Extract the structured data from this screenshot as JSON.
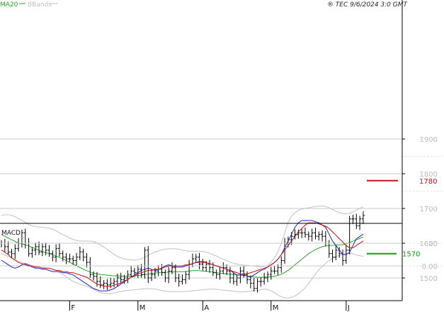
{
  "header": {
    "ma_label": "MA20",
    "bbands_label": "BBands",
    "copyright": "® TEC 9/6/2024 3:0 GMT"
  },
  "colors": {
    "ma": "#22aa22",
    "bbands": "#c0c0c0",
    "price_bar": "#000000",
    "macd_line": "#2222cc",
    "signal_line": "#cc1111",
    "resistance": "#cc1111",
    "support": "#119911",
    "grid": "#c8c8c8"
  },
  "chart_data": [
    {
      "type": "bar",
      "subtype": "ohlc",
      "x_labels": [
        "F",
        "M",
        "A",
        "M",
        "J"
      ],
      "x_label_positions": [
        20,
        40,
        59,
        79,
        101
      ],
      "y_ticks": [
        1500,
        1600,
        1700,
        1800,
        1900
      ],
      "ylim": [
        1420,
        1960
      ],
      "levels": [
        {
          "value": 1780,
          "label": "1780",
          "color": "#cc1111"
        },
        {
          "value": 1570,
          "label": "1570",
          "color": "#119911"
        }
      ],
      "close": [
        1600,
        1590,
        1575,
        1570,
        1585,
        1600,
        1630,
        1600,
        1570,
        1580,
        1590,
        1575,
        1590,
        1580,
        1570,
        1560,
        1585,
        1570,
        1560,
        1555,
        1555,
        1550,
        1560,
        1575,
        1560,
        1545,
        1510,
        1505,
        1490,
        1480,
        1485,
        1480,
        1485,
        1490,
        1500,
        1495,
        1500,
        1510,
        1520,
        1515,
        1525,
        1510,
        1580,
        1500,
        1510,
        1520,
        1525,
        1515,
        1500,
        1520,
        1530,
        1500,
        1490,
        1495,
        1510,
        1540,
        1555,
        1560,
        1540,
        1530,
        1540,
        1530,
        1515,
        1510,
        1520,
        1530,
        1520,
        1500,
        1490,
        1500,
        1520,
        1510,
        1495,
        1485,
        1470,
        1490,
        1490,
        1500,
        1510,
        1520,
        1520,
        1530,
        1550,
        1600,
        1610,
        1620,
        1625,
        1630,
        1630,
        1625,
        1620,
        1630,
        1620,
        1625,
        1620,
        1600,
        1570,
        1560,
        1580,
        1570,
        1550,
        1580,
        1670,
        1670,
        1650,
        1670,
        1680
      ],
      "ma20": [
        1625,
        1620,
        1615,
        1610,
        1605,
        1600,
        1598,
        1596,
        1592,
        1588,
        1584,
        1580,
        1576,
        1573,
        1570,
        1567,
        1563,
        1559,
        1555,
        1550,
        1545,
        1540,
        1535,
        1530,
        1525,
        1521,
        1517,
        1514,
        1512,
        1510,
        1509,
        1508,
        1507,
        1506,
        1506,
        1505,
        1505,
        1505,
        1505,
        1506,
        1507,
        1508,
        1510,
        1511,
        1513,
        1514,
        1515,
        1516,
        1516,
        1517,
        1517,
        1518,
        1518,
        1518,
        1519,
        1520,
        1521,
        1521,
        1521,
        1520,
        1519,
        1518,
        1517,
        1515,
        1514,
        1513,
        1512,
        1511,
        1510,
        1509,
        1508,
        1507,
        1506,
        1505,
        1503,
        1502,
        1502,
        1502,
        1503,
        1504,
        1505,
        1507,
        1511,
        1516,
        1522,
        1530,
        1538,
        1546,
        1554,
        1562,
        1570,
        1576,
        1582,
        1586,
        1590,
        1592,
        1593,
        1594,
        1595,
        1595,
        1596,
        1598,
        1602,
        1606,
        1610,
        1614,
        1618
      ],
      "bb_upper": [
        1680,
        1682,
        1682,
        1680,
        1676,
        1671,
        1666,
        1660,
        1654,
        1650,
        1648,
        1647,
        1646,
        1645,
        1643,
        1640,
        1636,
        1630,
        1625,
        1620,
        1615,
        1611,
        1608,
        1606,
        1606,
        1606,
        1606,
        1605,
        1600,
        1595,
        1589,
        1582,
        1575,
        1568,
        1562,
        1558,
        1555,
        1553,
        1552,
        1551,
        1552,
        1555,
        1560,
        1565,
        1570,
        1575,
        1578,
        1581,
        1583,
        1584,
        1584,
        1584,
        1583,
        1580,
        1578,
        1577,
        1577,
        1577,
        1577,
        1576,
        1574,
        1571,
        1567,
        1563,
        1558,
        1554,
        1550,
        1546,
        1542,
        1540,
        1538,
        1537,
        1536,
        1535,
        1534,
        1533,
        1533,
        1534,
        1536,
        1545,
        1558,
        1575,
        1600,
        1630,
        1660,
        1678,
        1688,
        1695,
        1698,
        1700,
        1702,
        1704,
        1706,
        1707,
        1707,
        1706,
        1702,
        1697,
        1692,
        1688,
        1685,
        1685,
        1686,
        1690,
        1695,
        1700,
        1705
      ],
      "bb_lower": [
        1570,
        1566,
        1562,
        1558,
        1553,
        1548,
        1544,
        1541,
        1538,
        1535,
        1533,
        1531,
        1530,
        1529,
        1528,
        1526,
        1522,
        1516,
        1510,
        1503,
        1496,
        1490,
        1486,
        1482,
        1479,
        1476,
        1472,
        1468,
        1462,
        1458,
        1456,
        1455,
        1455,
        1457,
        1459,
        1461,
        1463,
        1464,
        1465,
        1466,
        1467,
        1468,
        1469,
        1469,
        1469,
        1468,
        1466,
        1464,
        1462,
        1461,
        1461,
        1461,
        1461,
        1461,
        1461,
        1462,
        1463,
        1464,
        1465,
        1466,
        1467,
        1468,
        1468,
        1467,
        1466,
        1465,
        1464,
        1463,
        1462,
        1461,
        1460,
        1460,
        1461,
        1462,
        1463,
        1464,
        1466,
        1468,
        1467,
        1463,
        1458,
        1451,
        1446,
        1443,
        1442,
        1444,
        1448,
        1455,
        1462,
        1472,
        1484,
        1497,
        1511,
        1523,
        1533,
        1542,
        1550,
        1556,
        1561,
        1565,
        1568,
        1570,
        1572,
        1570,
        1566,
        1564,
        1562
      ]
    },
    {
      "type": "line",
      "title": "MACD",
      "y_ticks": [
        0,
        20
      ],
      "y_tick_labels": [
        "0.00",
        "20"
      ],
      "ylim": [
        -25,
        52
      ],
      "series": [
        {
          "name": "MACD",
          "values": [
            5,
            3,
            1,
            -1,
            -2,
            -1,
            1,
            2,
            1,
            -1,
            -2,
            -2,
            -3,
            -3,
            -4,
            -5,
            -5,
            -5,
            -6,
            -6,
            -7,
            -8,
            -10,
            -12,
            -14,
            -16,
            -18,
            -20,
            -21,
            -22,
            -22,
            -22,
            -21,
            -20,
            -18,
            -16,
            -14,
            -12,
            -10,
            -8,
            -6,
            -4,
            -3,
            -2,
            -3,
            -4,
            -3,
            -2,
            0,
            1,
            0,
            -1,
            -1,
            -1,
            0,
            1,
            2,
            3,
            4,
            4,
            3,
            2,
            1,
            0,
            -1,
            -2,
            -3,
            -4,
            -6,
            -8,
            -8,
            -8,
            -9,
            -10,
            -8,
            -6,
            -4,
            -3,
            -1,
            1,
            3,
            6,
            10,
            16,
            22,
            28,
            34,
            38,
            40,
            40,
            40,
            40,
            39,
            38,
            36,
            34,
            28,
            22,
            18,
            14,
            10,
            10,
            12,
            18,
            24,
            26,
            28
          ]
        },
        {
          "name": "Signal",
          "values": [
            14,
            12,
            10,
            7,
            5,
            3,
            2,
            1,
            0,
            0,
            -1,
            -1,
            -2,
            -2,
            -2,
            -3,
            -4,
            -4,
            -5,
            -5,
            -6,
            -6,
            -7,
            -8,
            -9,
            -10,
            -12,
            -14,
            -16,
            -17,
            -18,
            -18,
            -18,
            -17,
            -16,
            -15,
            -13,
            -12,
            -10,
            -9,
            -7,
            -6,
            -5,
            -4,
            -4,
            -3,
            -3,
            -2,
            -1,
            0,
            0,
            0,
            0,
            0,
            1,
            1,
            2,
            3,
            3,
            3,
            3,
            2,
            1,
            0,
            -1,
            -2,
            -3,
            -4,
            -5,
            -6,
            -7,
            -7,
            -7,
            -6,
            -5,
            -4,
            -3,
            -2,
            -1,
            1,
            3,
            6,
            10,
            14,
            18,
            22,
            26,
            30,
            33,
            36,
            38,
            38,
            38,
            37,
            36,
            35,
            33,
            30,
            27,
            24,
            21,
            18,
            16,
            16,
            18,
            20,
            22
          ]
        }
      ]
    }
  ]
}
